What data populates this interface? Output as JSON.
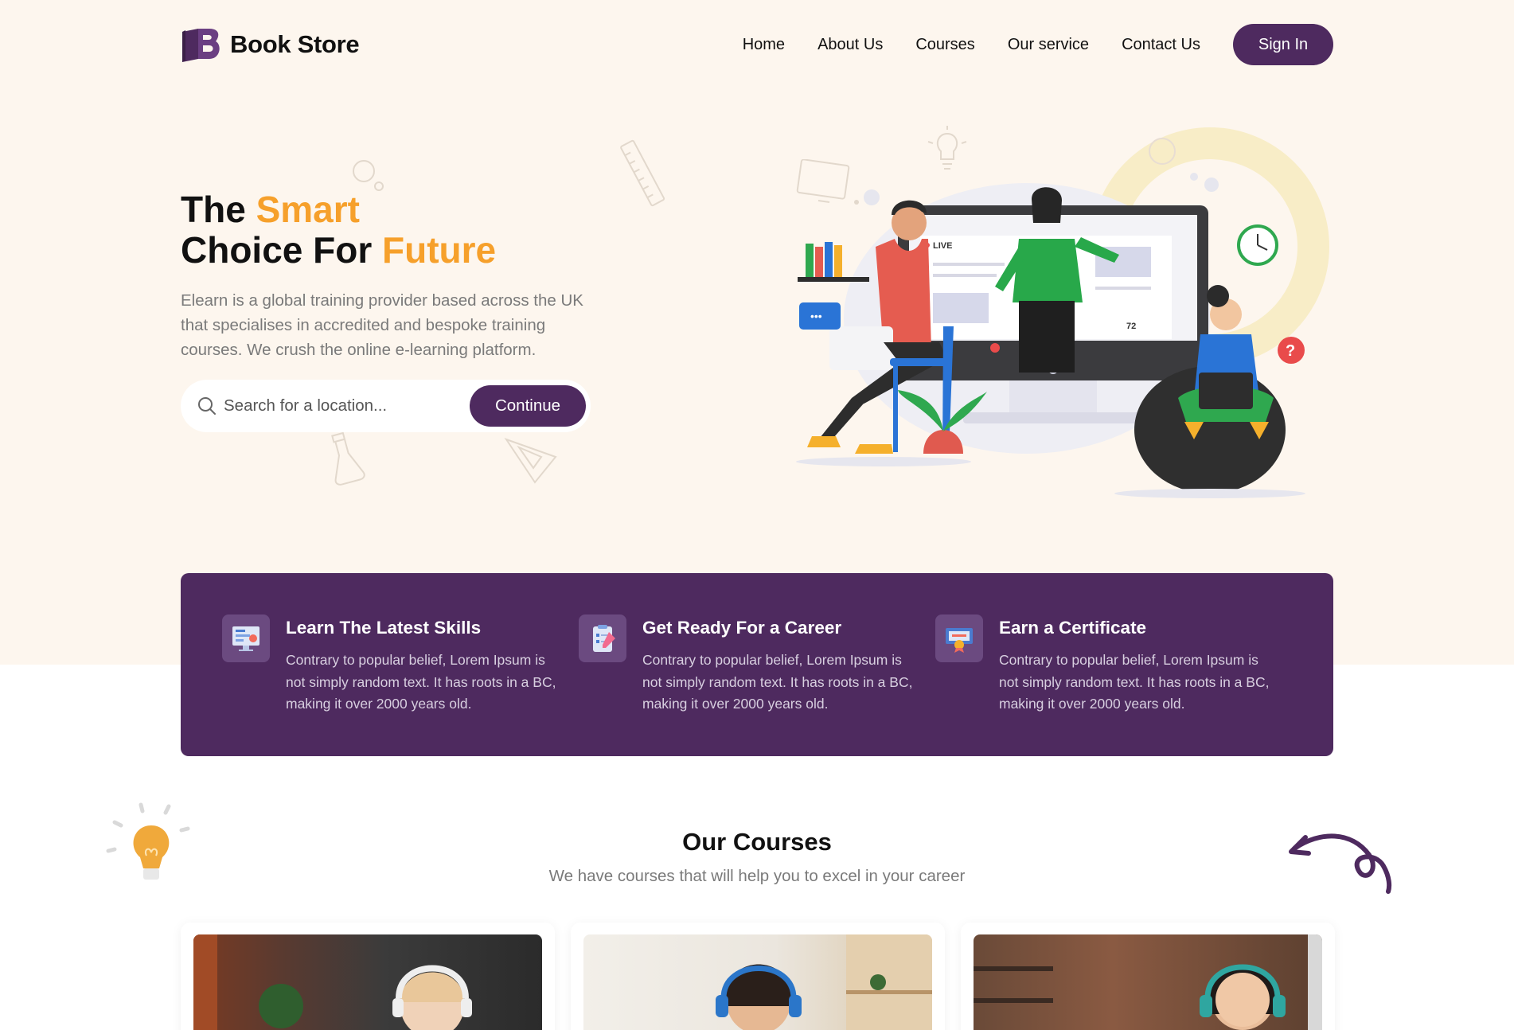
{
  "brand": {
    "name": "Book Store",
    "logo_icon": "book-b-logo-icon"
  },
  "nav": {
    "links": [
      "Home",
      "About Us",
      "Courses",
      "Our service",
      "Contact Us"
    ],
    "signin_label": "Sign In"
  },
  "hero": {
    "title_line1_plain": "The ",
    "title_line1_accent": "Smart",
    "title_line2_plain": "Choice For ",
    "title_line2_accent": "Future",
    "description": "Elearn is a global training provider based across the UK that specialises in accredited and bespoke training courses. We crush the online e-learning platform.",
    "search_placeholder": "Search for a location...",
    "search_value": "",
    "continue_label": "Continue",
    "screen_live_label": "LIVE",
    "screen_viewers": "72"
  },
  "features": [
    {
      "icon": "monitor-presentation-icon",
      "title": "Learn The Latest Skills",
      "desc": "Contrary to popular belief, Lorem Ipsum is not simply random text. It has roots in a BC, making it over 2000 years old."
    },
    {
      "icon": "checklist-pencil-icon",
      "title": "Get Ready For a Career",
      "desc": "Contrary to popular belief, Lorem Ipsum is not simply random text. It has roots in a BC, making it over 2000 years old."
    },
    {
      "icon": "certificate-icon",
      "title": "Earn a Certificate",
      "desc": "Contrary to popular belief, Lorem Ipsum is not simply random text. It has roots in a BC, making it over 2000 years old."
    }
  ],
  "courses": {
    "title": "Our Courses",
    "subtitle": "We have courses that will help you to excel in your career"
  },
  "colors": {
    "brand_purple": "#4e2a5f",
    "accent_orange": "#f6a02b",
    "hero_bg": "#fdf6ee"
  }
}
